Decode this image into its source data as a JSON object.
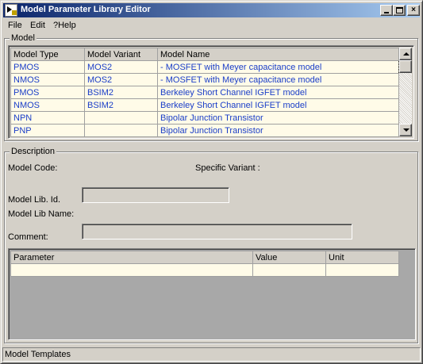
{
  "window": {
    "title": "Model Parameter Library Editor",
    "minimize_glyph": "_",
    "maximize_glyph": "□",
    "close_glyph": "×"
  },
  "menu": [
    "File",
    "Edit",
    "?Help"
  ],
  "model_group": {
    "title": "Model",
    "columns": [
      "Model Type",
      "Model Variant",
      "Model Name"
    ],
    "rows": [
      [
        "PMOS",
        "MOS2",
        "- MOSFET with Meyer capacitance model"
      ],
      [
        "NMOS",
        "MOS2",
        "- MOSFET with Meyer capacitance model"
      ],
      [
        "PMOS",
        "BSIM2",
        "Berkeley Short Channel IGFET model"
      ],
      [
        "NMOS",
        "BSIM2",
        "Berkeley Short Channel IGFET model"
      ],
      [
        "NPN",
        "",
        "Bipolar Junction Transistor"
      ],
      [
        "PNP",
        "",
        "Bipolar Junction Transistor"
      ]
    ]
  },
  "description_group": {
    "title": "Description",
    "model_code_label": "Model Code:",
    "specific_variant_label": "Specific Variant :",
    "model_lib_id_label": "Model Lib. Id.",
    "model_lib_id_value": "",
    "model_lib_name_label": "Model Lib Name:",
    "comment_label": "Comment:",
    "comment_value": "",
    "param_columns": [
      "Parameter",
      "Value",
      "Unit"
    ]
  },
  "status": "Model Templates",
  "colors": {
    "cell_text": "#1a3ec8",
    "cell_background": "#fffbe8",
    "titlebar_start": "#0a246a",
    "titlebar_end": "#a6caf0",
    "face": "#d4d0c8",
    "empty_area": "#a8a8a8"
  }
}
